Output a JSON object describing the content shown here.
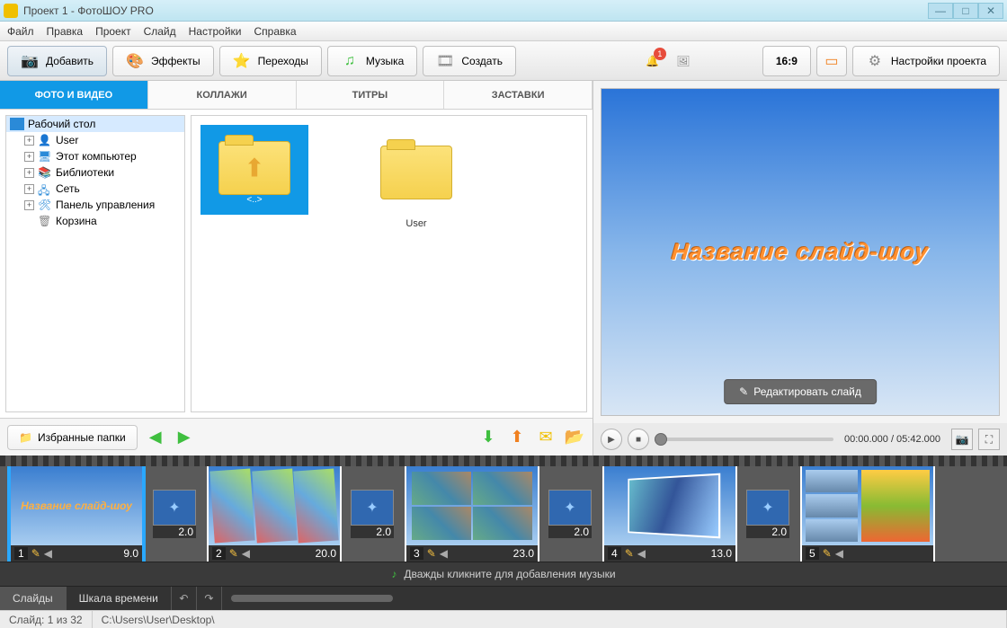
{
  "window": {
    "title": "Проект 1 - ФотоШОУ PRO"
  },
  "menu": {
    "file": "Файл",
    "edit": "Правка",
    "project": "Проект",
    "slide": "Слайд",
    "settings": "Настройки",
    "help": "Справка"
  },
  "toolbar": {
    "add": "Добавить",
    "effects": "Эффекты",
    "transitions": "Переходы",
    "music": "Музыка",
    "create": "Создать",
    "notif_count": "1",
    "aspect": "16:9",
    "project_settings": "Настройки проекта"
  },
  "subtabs": {
    "photo": "ФОТО И ВИДЕО",
    "collage": "КОЛЛАЖИ",
    "titles": "ТИТРЫ",
    "splash": "ЗАСТАВКИ"
  },
  "tree": {
    "root": "Рабочий стол",
    "items": [
      {
        "label": "User"
      },
      {
        "label": "Этот компьютер"
      },
      {
        "label": "Библиотеки"
      },
      {
        "label": "Сеть"
      },
      {
        "label": "Панель управления"
      },
      {
        "label": "Корзина"
      }
    ]
  },
  "thumbs": {
    "up": "<..>",
    "user": "User"
  },
  "leftbottom": {
    "fav": "Избранные папки"
  },
  "preview": {
    "title": "Название слайд-шоу",
    "edit": "Редактировать слайд"
  },
  "playbar": {
    "time": "00:00.000 / 05:42.000"
  },
  "timeline": {
    "slides": [
      {
        "n": "1",
        "dur": "9.0",
        "trans": "2.0"
      },
      {
        "n": "2",
        "dur": "20.0",
        "trans": "2.0"
      },
      {
        "n": "3",
        "dur": "23.0",
        "trans": "2.0"
      },
      {
        "n": "4",
        "dur": "13.0",
        "trans": "2.0"
      },
      {
        "n": "5",
        "dur": "",
        "trans": ""
      }
    ],
    "music_hint": "Дважды кликните для добавления музыки",
    "tabs": {
      "slides": "Слайды",
      "time": "Шкала времени"
    }
  },
  "status": {
    "slide": "Слайд: 1 из 32",
    "path": "C:\\Users\\User\\Desktop\\"
  }
}
